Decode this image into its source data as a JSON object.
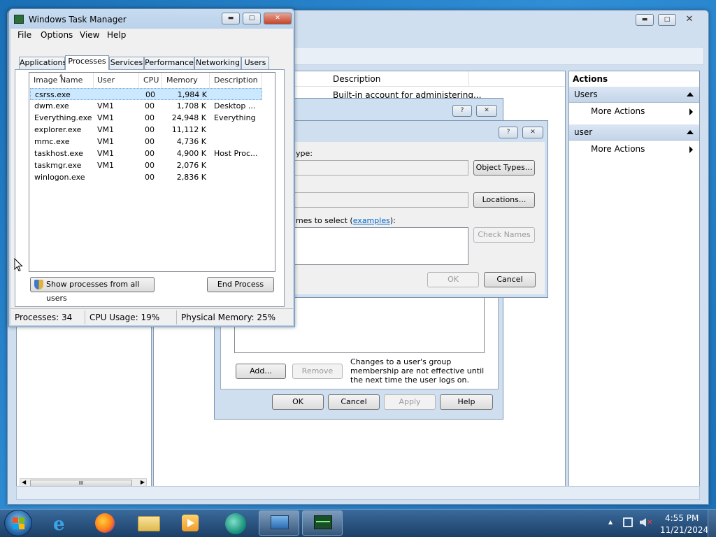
{
  "task_manager": {
    "title": "Windows Task Manager",
    "menu": [
      "File",
      "Options",
      "View",
      "Help"
    ],
    "tabs": [
      "Applications",
      "Processes",
      "Services",
      "Performance",
      "Networking",
      "Users"
    ],
    "columns": [
      "Image Name",
      "User Name",
      "CPU",
      "Memory (...",
      "Description"
    ],
    "processes": [
      {
        "name": "csrss.exe",
        "user": "",
        "cpu": "00",
        "mem": "1,984 K",
        "desc": ""
      },
      {
        "name": "dwm.exe",
        "user": "VM1",
        "cpu": "00",
        "mem": "1,708 K",
        "desc": "Desktop ..."
      },
      {
        "name": "Everything.exe",
        "user": "VM1",
        "cpu": "00",
        "mem": "24,948 K",
        "desc": "Everything"
      },
      {
        "name": "explorer.exe",
        "user": "VM1",
        "cpu": "00",
        "mem": "11,112 K",
        "desc": ""
      },
      {
        "name": "mmc.exe",
        "user": "VM1",
        "cpu": "00",
        "mem": "4,736 K",
        "desc": ""
      },
      {
        "name": "taskhost.exe",
        "user": "VM1",
        "cpu": "00",
        "mem": "4,900 K",
        "desc": "Host Proc..."
      },
      {
        "name": "taskmgr.exe",
        "user": "VM1",
        "cpu": "00",
        "mem": "2,076 K",
        "desc": ""
      },
      {
        "name": "winlogon.exe",
        "user": "",
        "cpu": "00",
        "mem": "2,836 K",
        "desc": ""
      }
    ],
    "show_all_label": "Show processes from all users",
    "end_process_label": "End Process",
    "status": {
      "processes": "Processes: 34",
      "cpu": "CPU Usage: 19%",
      "memory": "Physical Memory: 25%"
    }
  },
  "mmc": {
    "description_header": "Description",
    "description_value": "Built-in account for administering...",
    "actions_title": "Actions",
    "sections": [
      {
        "title": "Users",
        "item": "More Actions"
      },
      {
        "title": "user",
        "item": "More Actions"
      }
    ],
    "hscroll_glyph": "III"
  },
  "select_dialog": {
    "object_type_label": "ype:",
    "object_types_button": "Object Types...",
    "locations_button": "Locations...",
    "names_label_prefix": "mes to select (",
    "names_label_link": "examples",
    "names_label_suffix": "):",
    "check_names_button": "Check Names",
    "ok_button": "OK",
    "cancel_button": "Cancel",
    "help_glyph": "?"
  },
  "properties_dialog": {
    "add_button": "Add...",
    "remove_button": "Remove",
    "note": "Changes to a user's group membership are not effective until the next time the user logs on.",
    "ok_button": "OK",
    "cancel_button": "Cancel",
    "apply_button": "Apply",
    "help_button": "Help"
  },
  "taskbar": {
    "time": "4:55 PM",
    "date": "11/21/2024"
  },
  "colors": {
    "taskbar": "#1c3f66",
    "selection": "#cce8ff",
    "link": "#0066cc"
  }
}
